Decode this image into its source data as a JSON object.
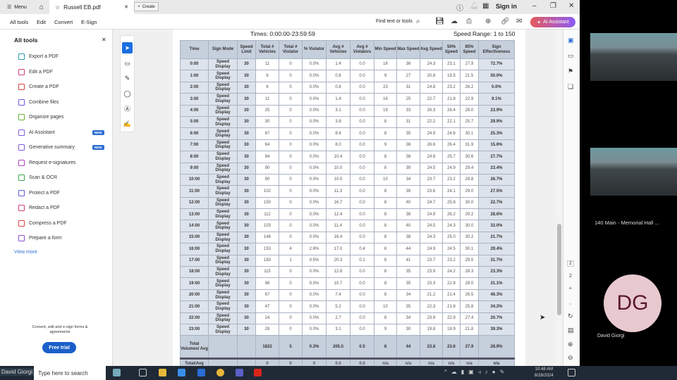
{
  "titlebar": {
    "menu": "Menu",
    "tab_title": "Russell EB.pdf",
    "create": "Create",
    "sign_in": "Sign in"
  },
  "menubar": {
    "tabs": [
      "All tools",
      "Edit",
      "Convert",
      "E-Sign"
    ],
    "find": "Find text or tools",
    "ai_assistant": "AI Assistant"
  },
  "sidebar": {
    "title": "All tools",
    "items": [
      {
        "label": "Export a PDF",
        "color": "#2a9bb0"
      },
      {
        "label": "Edit a PDF",
        "color": "#d0417f"
      },
      {
        "label": "Create a PDF",
        "color": "#d9413f"
      },
      {
        "label": "Combine files",
        "color": "#6c5ce7"
      },
      {
        "label": "Organize pages",
        "color": "#6aae3a"
      },
      {
        "label": "AI Assistant",
        "color": "#7b5cdb",
        "badge": "NEW"
      },
      {
        "label": "Generative summary",
        "color": "#7b5cdb",
        "badge": "NEW"
      },
      {
        "label": "Request e-signatures",
        "color": "#b044b8"
      },
      {
        "label": "Scan & OCR",
        "color": "#3aa64a"
      },
      {
        "label": "Protect a PDF",
        "color": "#5a5ad6"
      },
      {
        "label": "Redact a PDF",
        "color": "#d0417f"
      },
      {
        "label": "Compress a PDF",
        "color": "#d9413f"
      },
      {
        "label": "Prepare a form",
        "color": "#8a4fd0"
      }
    ],
    "view_more": "View more",
    "promo": "Convert, edit and e-sign forms & agreements",
    "free_trial": "Free trial"
  },
  "document": {
    "times": "Times: 0:00:00-23:59:59",
    "speed_range": "Speed Range: 1 to 150",
    "headers": [
      "Time",
      "Sign Mode",
      "Speed Limit",
      "Total # Vehicles",
      "Total # Violator",
      "% Violator",
      "Avg # Vehicles",
      "Avg # Violators",
      "Min Speed",
      "Max Speed",
      "Avg Speed",
      "50% Speed",
      "85% Speed",
      "Sign Effectiveness"
    ],
    "rows": [
      [
        "0:00",
        "Speed Display",
        "30",
        "11",
        "0",
        "0.0%",
        "1.4",
        "0.0",
        "16",
        "36",
        "24.3",
        "23.1",
        "27.9",
        "72.7%"
      ],
      [
        "1:00",
        "Speed Display",
        "30",
        "6",
        "0",
        "0.0%",
        "0.8",
        "0.0",
        "9",
        "27",
        "20.8",
        "19.5",
        "21.5",
        "50.0%"
      ],
      [
        "2:00",
        "Speed Display",
        "30",
        "6",
        "0",
        "0.0%",
        "0.8",
        "0.0",
        "23",
        "31",
        "24.8",
        "23.2",
        "26.2",
        "0.0%"
      ],
      [
        "3:00",
        "Speed Display",
        "30",
        "11",
        "0",
        "0.0%",
        "1.4",
        "0.0",
        "16",
        "25",
        "22.7",
        "21.8",
        "22.9",
        "9.1%"
      ],
      [
        "4:00",
        "Speed Display",
        "30",
        "25",
        "0",
        "0.0%",
        "3.1",
        "0.0",
        "19",
        "33",
        "26.3",
        "26.4",
        "28.0",
        "23.9%"
      ],
      [
        "5:00",
        "Speed Display",
        "30",
        "30",
        "0",
        "0.0%",
        "3.8",
        "0.0",
        "8",
        "31",
        "22.2",
        "22.1",
        "25.7",
        "29.9%"
      ],
      [
        "6:00",
        "Speed Display",
        "30",
        "67",
        "0",
        "0.0%",
        "8.4",
        "0.0",
        "8",
        "35",
        "24.9",
        "24.6",
        "30.1",
        "25.3%"
      ],
      [
        "7:00",
        "Speed Display",
        "30",
        "64",
        "0",
        "0.0%",
        "8.0",
        "0.0",
        "9",
        "36",
        "26.6",
        "26.4",
        "31.9",
        "15.6%"
      ],
      [
        "8:00",
        "Speed Display",
        "30",
        "94",
        "0",
        "0.0%",
        "10.4",
        "0.0",
        "8",
        "38",
        "24.9",
        "25.7",
        "30.6",
        "27.7%"
      ],
      [
        "9:00",
        "Speed Display",
        "30",
        "90",
        "0",
        "0.0%",
        "10.0",
        "0.0",
        "8",
        "39",
        "24.5",
        "24.9",
        "29.4",
        "23.4%"
      ],
      [
        "10:00",
        "Speed Display",
        "30",
        "90",
        "0",
        "0.0%",
        "10.0",
        "0.0",
        "10",
        "34",
        "23.7",
        "23.2",
        "28.8",
        "26.7%"
      ],
      [
        "11:00",
        "Speed Display",
        "30",
        "102",
        "0",
        "0.0%",
        "11.3",
        "0.0",
        "8",
        "39",
        "23.6",
        "24.1",
        "29.0",
        "27.5%"
      ],
      [
        "12:00",
        "Speed Display",
        "30",
        "150",
        "0",
        "0.0%",
        "16.7",
        "0.0",
        "8",
        "40",
        "24.7",
        "25.8",
        "30.0",
        "22.7%"
      ],
      [
        "13:00",
        "Speed Display",
        "30",
        "112",
        "0",
        "0.0%",
        "12.4",
        "0.0",
        "8",
        "38",
        "24.9",
        "26.2",
        "29.2",
        "28.6%"
      ],
      [
        "14:00",
        "Speed Display",
        "30",
        "103",
        "0",
        "0.0%",
        "11.4",
        "0.0",
        "8",
        "40",
        "24.5",
        "24.3",
        "30.0",
        "32.0%"
      ],
      [
        "15:00",
        "Speed Display",
        "30",
        "148",
        "0",
        "0.0%",
        "16.4",
        "0.0",
        "8",
        "38",
        "24.3",
        "25.0",
        "30.2",
        "21.7%"
      ],
      [
        "16:00",
        "Speed Display",
        "30",
        "153",
        "4",
        "2.6%",
        "17.0",
        "0.4",
        "8",
        "44",
        "24.9",
        "24.5",
        "30.1",
        "29.4%"
      ],
      [
        "17:00",
        "Speed Display",
        "30",
        "183",
        "1",
        "0.5%",
        "20.3",
        "0.1",
        "8",
        "41",
        "23.7",
        "23.2",
        "29.5",
        "31.7%"
      ],
      [
        "18:00",
        "Speed Display",
        "30",
        "115",
        "0",
        "0.0%",
        "12.8",
        "0.0",
        "8",
        "35",
        "23.9",
        "24.2",
        "28.3",
        "23.3%"
      ],
      [
        "19:00",
        "Speed Display",
        "30",
        "96",
        "0",
        "0.0%",
        "10.7",
        "0.0",
        "8",
        "35",
        "23.3",
        "22.8",
        "28.0",
        "31.1%"
      ],
      [
        "20:00",
        "Speed Display",
        "30",
        "67",
        "0",
        "0.0%",
        "7.4",
        "0.0",
        "8",
        "34",
        "21.2",
        "21.4",
        "26.5",
        "46.3%"
      ],
      [
        "21:00",
        "Speed Display",
        "30",
        "47",
        "0",
        "0.0%",
        "5.2",
        "0.0",
        "10",
        "35",
        "22.3",
        "21.8",
        "25.8",
        "34.2%"
      ],
      [
        "22:00",
        "Speed Display",
        "30",
        "24",
        "0",
        "0.0%",
        "2.7",
        "0.0",
        "8",
        "34",
        "23.9",
        "22.9",
        "27.4",
        "20.7%"
      ],
      [
        "23:00",
        "Speed Display",
        "30",
        "28",
        "0",
        "0.0%",
        "3.1",
        "0.0",
        "9",
        "30",
        "19.8",
        "18.9",
        "21.8",
        "39.3%"
      ]
    ],
    "total": [
      "Total Volumes/ Avg",
      "",
      "",
      "1822",
      "5",
      "0.3%",
      "205.5",
      "0.5",
      "8",
      "44",
      "23.8",
      "23.6",
      "27.9",
      "28.9%"
    ],
    "total2": [
      "Total/Avg",
      "",
      "",
      "0",
      "0",
      "0",
      "0.0",
      "0.0",
      "n/a",
      "n/a",
      "n/a",
      "n/a",
      "n/a",
      "n/a"
    ]
  },
  "rail": {
    "page_current": "2",
    "page_total": "2"
  },
  "video": {
    "room": "140 Main - Memorial Hall ...",
    "initials": "DG",
    "name": "David Giorgi"
  },
  "taskbar": {
    "user": "David Giorgi",
    "search": "Type here to search",
    "time": "10:48 AM",
    "date": "8/28/2024"
  }
}
